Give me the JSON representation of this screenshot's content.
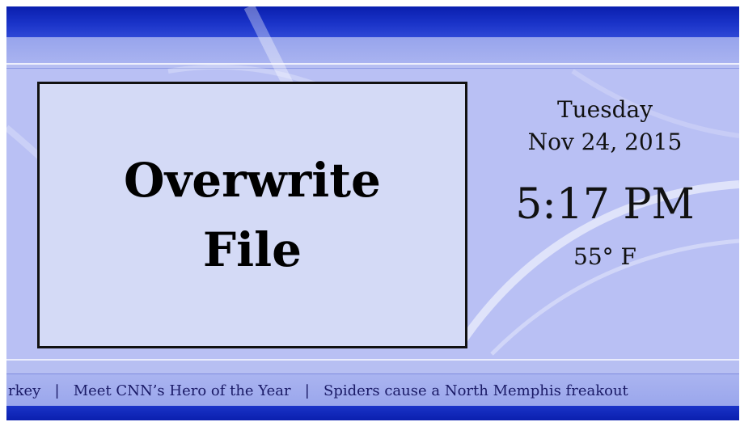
{
  "message": {
    "line1": "Overwrite",
    "line2": "File"
  },
  "info": {
    "day": "Tuesday",
    "date": "Nov 24, 2015",
    "time": "5:17 PM",
    "temperature": "55° F"
  },
  "ticker": {
    "text": "rkey   |   Meet CNN’s Hero of the Year   |   Spiders cause a North Memphis freakout"
  },
  "colors": {
    "top_bar": "#0a1fae",
    "background": "#b9c0f4",
    "message_box": "#d4daf6",
    "border": "#111111"
  }
}
